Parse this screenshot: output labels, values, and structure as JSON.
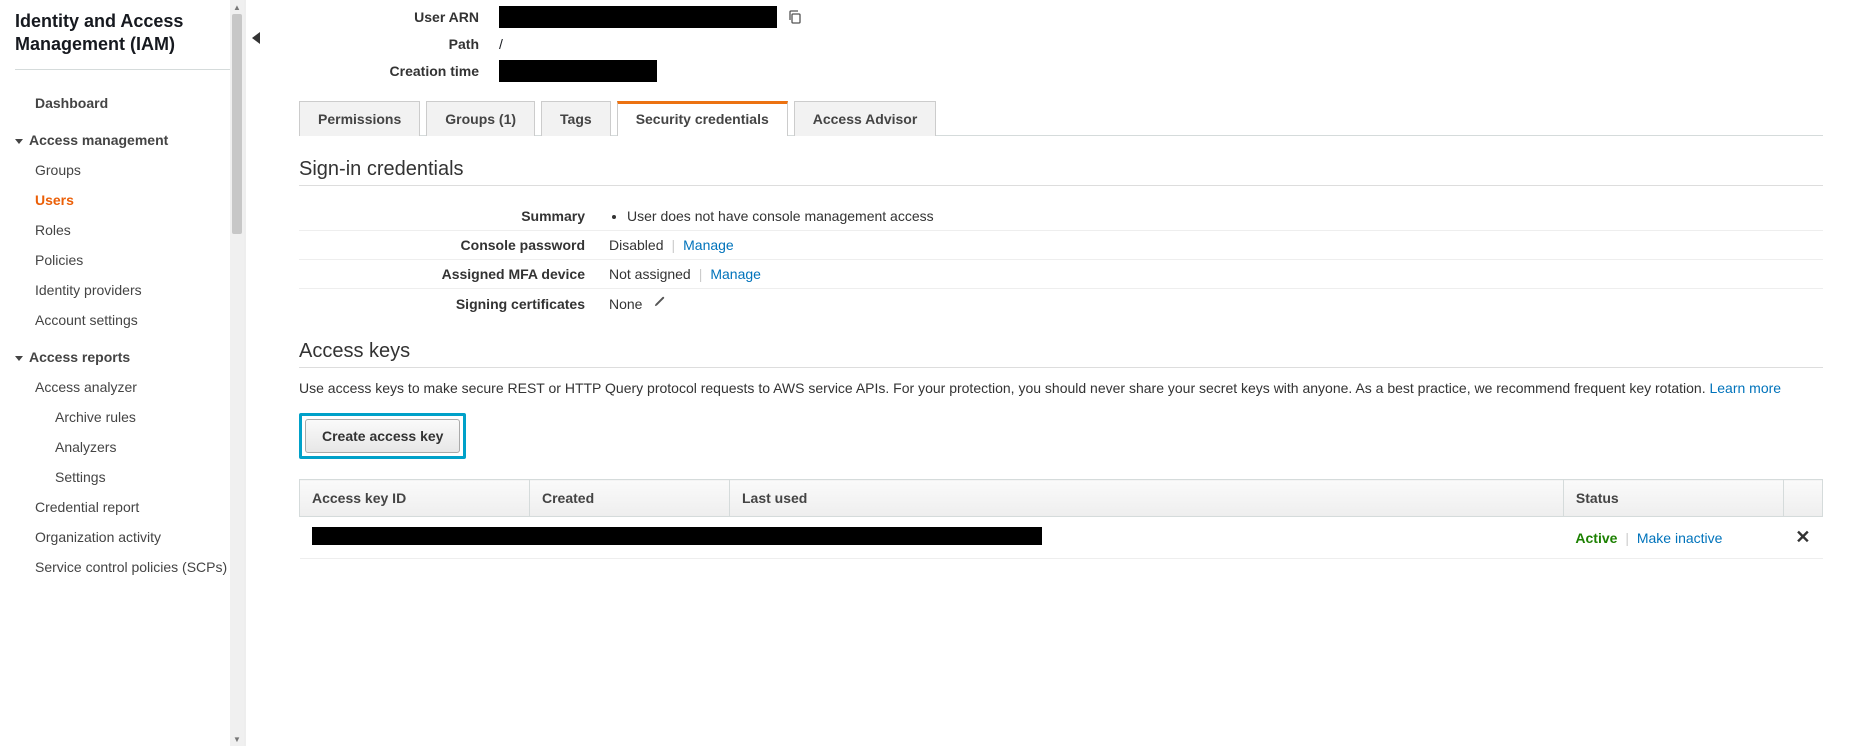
{
  "sidebar": {
    "title": "Identity and Access Management (IAM)",
    "dashboard": "Dashboard",
    "sections": [
      {
        "label": "Access management",
        "items": [
          {
            "label": "Groups"
          },
          {
            "label": "Users",
            "active": true
          },
          {
            "label": "Roles"
          },
          {
            "label": "Policies"
          },
          {
            "label": "Identity providers"
          },
          {
            "label": "Account settings"
          }
        ]
      },
      {
        "label": "Access reports",
        "items": [
          {
            "label": "Access analyzer"
          },
          {
            "label": "Archive rules",
            "indent": true
          },
          {
            "label": "Analyzers",
            "indent": true
          },
          {
            "label": "Settings",
            "indent": true
          },
          {
            "label": "Credential report"
          },
          {
            "label": "Organization activity"
          },
          {
            "label": "Service control policies (SCPs)"
          }
        ]
      }
    ]
  },
  "userInfo": {
    "arnLabel": "User ARN",
    "pathLabel": "Path",
    "pathValue": "/",
    "creationLabel": "Creation time"
  },
  "tabs": {
    "permissions": "Permissions",
    "groups": "Groups (1)",
    "tags": "Tags",
    "security": "Security credentials",
    "advisor": "Access Advisor"
  },
  "signin": {
    "title": "Sign-in credentials",
    "summaryLabel": "Summary",
    "summaryValue": "User does not have console management access",
    "consoleLabel": "Console password",
    "consoleValue": "Disabled",
    "manage": "Manage",
    "mfaLabel": "Assigned MFA device",
    "mfaValue": "Not assigned",
    "certLabel": "Signing certificates",
    "certValue": "None"
  },
  "accessKeys": {
    "title": "Access keys",
    "desc": "Use access keys to make secure REST or HTTP Query protocol requests to AWS service APIs. For your protection, you should never share your secret keys with anyone. As a best practice, we recommend frequent key rotation. ",
    "learnMore": "Learn more",
    "createBtn": "Create access key",
    "cols": {
      "id": "Access key ID",
      "created": "Created",
      "lastUsed": "Last used",
      "status": "Status"
    },
    "row": {
      "status": "Active",
      "inactive": "Make inactive"
    }
  }
}
